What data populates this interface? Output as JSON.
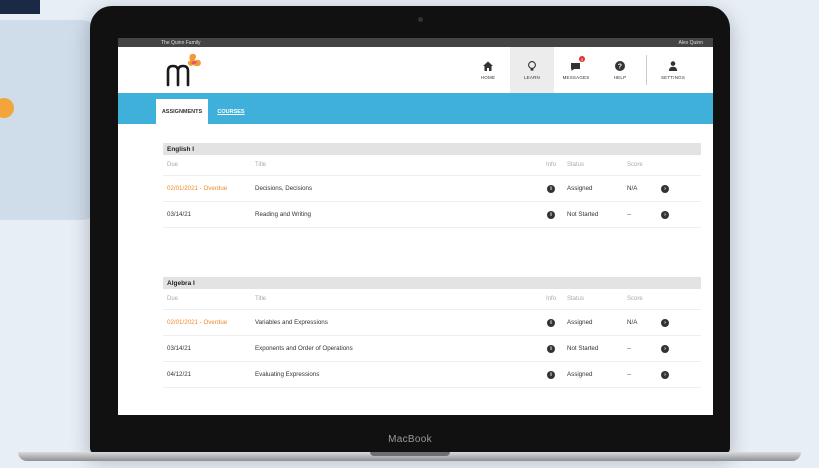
{
  "device": {
    "label": "MacBook"
  },
  "app": {
    "family_name": "The Quinn Family",
    "user_name": "Alex Quinn",
    "brand_color": "#3fb0da",
    "overdue_color": "#f08a2b"
  },
  "nav": [
    {
      "label": "Home",
      "icon": "home-icon"
    },
    {
      "label": "Learn",
      "icon": "lightbulb-icon"
    },
    {
      "label": "Messages",
      "icon": "messages-icon",
      "badge": "3"
    },
    {
      "label": "Help",
      "icon": "help-icon"
    },
    {
      "label": "Settings",
      "icon": "person-icon"
    }
  ],
  "tabs": {
    "assignments": "Assignments",
    "courses": "Courses"
  },
  "columns": {
    "due": "Due",
    "title": "Title",
    "info": "Info",
    "status": "Status",
    "score": "Score"
  },
  "courses": [
    {
      "name": "English I",
      "rows": [
        {
          "due": "02/01/2021 - Overdue",
          "title": "Decisions, Decisions",
          "status": "Assigned",
          "score": "N/A"
        },
        {
          "due": "03/14/21",
          "title": "Reading and Writing",
          "status": "Not Started",
          "score": "--"
        }
      ]
    },
    {
      "name": "Algebra I",
      "rows": [
        {
          "due": "02/01/2021 - Overdue",
          "title": "Variables and Expressions",
          "status": "Assigned",
          "score": "N/A"
        },
        {
          "due": "03/14/21",
          "title": "Exponents and Order of Operations",
          "status": "Not Started",
          "score": "--"
        },
        {
          "due": "04/12/21",
          "title": "Evaluating Expressions",
          "status": "Assigned",
          "score": "--"
        }
      ]
    }
  ]
}
